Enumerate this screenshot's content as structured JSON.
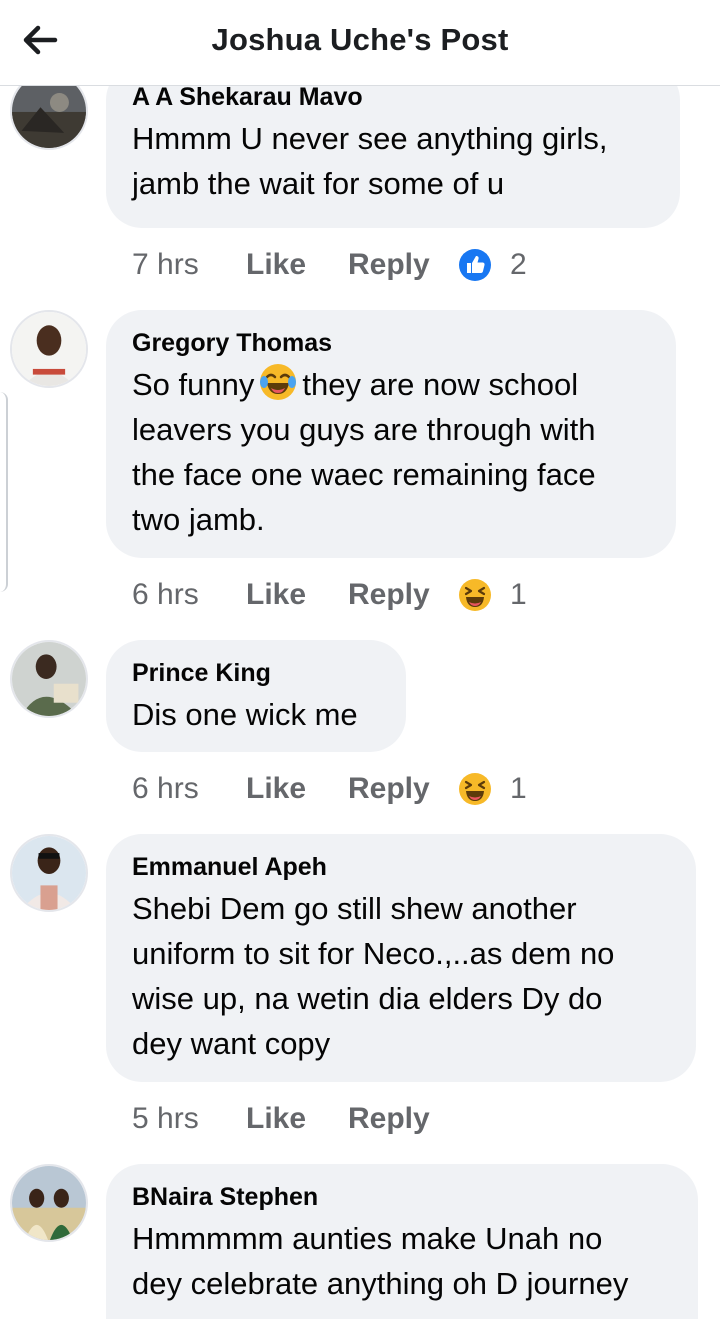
{
  "header": {
    "title": "Joshua Uche's Post",
    "back_icon": "arrow-left-icon"
  },
  "colors": {
    "like_blue": "#1877f2",
    "haha_yellow": "#f7b928",
    "bubble_bg": "#f0f2f5",
    "meta_gray": "#65676b"
  },
  "comments": [
    {
      "author": "A A Shekarau Mavo",
      "lines": [
        "Hmmm U never see anything girls,",
        "jamb the wait for some of u"
      ],
      "time": "7 hrs",
      "like": "Like",
      "reply": "Reply",
      "reaction": {
        "icon": "like-icon",
        "count": "2"
      }
    },
    {
      "author": "Gregory Thomas",
      "lines": [
        "So funny",
        "they are now school",
        "leavers you guys are through with",
        "the face one waec remaining face",
        "two jamb."
      ],
      "inline_emoji": "laughing-tears-emoji-icon",
      "time": "6 hrs",
      "like": "Like",
      "reply": "Reply",
      "reaction": {
        "icon": "haha-icon",
        "count": "1"
      }
    },
    {
      "author": "Prince King",
      "lines": [
        "Dis one wick me"
      ],
      "time": "6 hrs",
      "like": "Like",
      "reply": "Reply",
      "reaction": {
        "icon": "haha-icon",
        "count": "1"
      }
    },
    {
      "author": "Emmanuel Apeh",
      "lines": [
        "Shebi Dem go still shew another",
        "uniform to sit for Neco.,..as dem no",
        "wise up, na wetin dia elders Dy do",
        "dey want copy"
      ],
      "time": "5 hrs",
      "like": "Like",
      "reply": "Reply"
    },
    {
      "author": "BNaira Stephen",
      "lines": [
        "Hmmmmm aunties make Unah no",
        "dey celebrate anything oh D journey"
      ]
    }
  ]
}
